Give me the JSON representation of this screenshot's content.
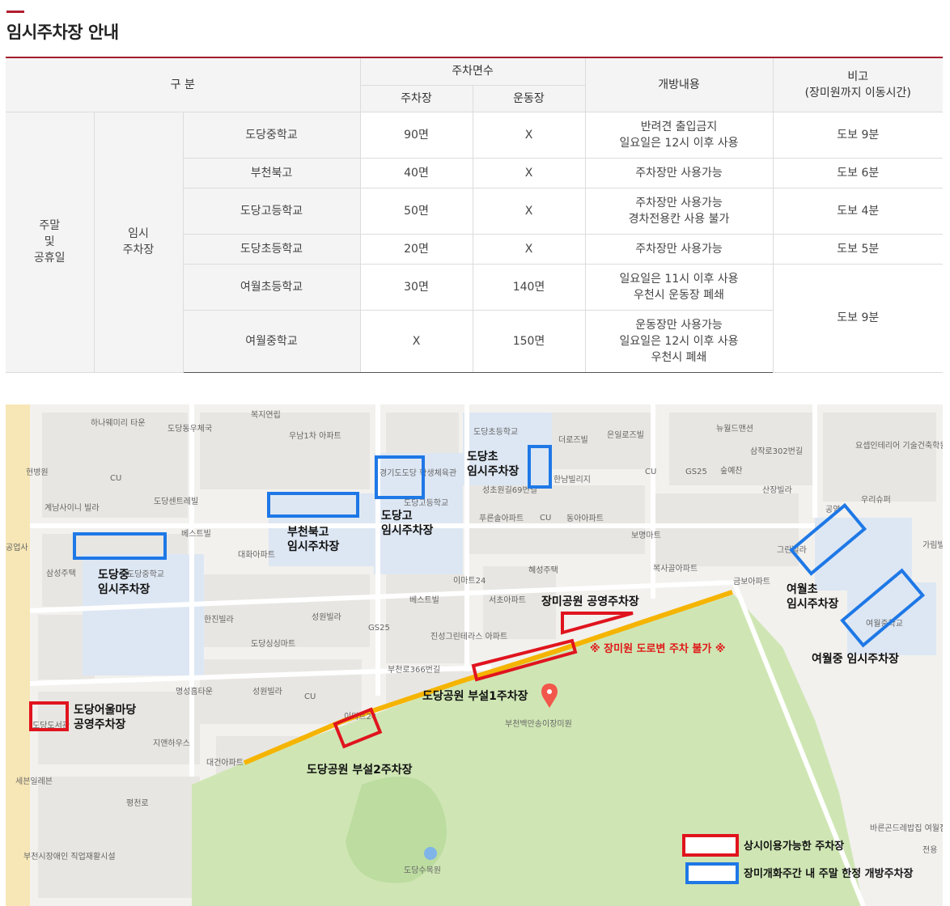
{
  "page": {
    "title": "임시주차장 안내"
  },
  "table": {
    "headers": {
      "division": "구 분",
      "capacity": "주차면수",
      "parking": "주차장",
      "field": "운동장",
      "open": "개방내용",
      "note": "비고\n(장미원까지 이동시간)"
    },
    "group_label": "주말\n및\n공휴일",
    "type_label": "임시\n주차장",
    "rows": [
      {
        "school": "도당중학교",
        "parking": "90면",
        "field": "X",
        "open": "반려견 출입금지\n일요일은 12시 이후 사용",
        "note": "도보 9분"
      },
      {
        "school": "부천북고",
        "parking": "40면",
        "field": "X",
        "open": "주차장만 사용가능",
        "note": "도보 6분"
      },
      {
        "school": "도당고등학교",
        "parking": "50면",
        "field": "X",
        "open": "주차장만 사용가능\n경차전용칸 사용 불가",
        "note": "도보 4분"
      },
      {
        "school": "도당초등학교",
        "parking": "20면",
        "field": "X",
        "open": "주차장만 사용가능",
        "note": "도보 5분"
      },
      {
        "school": "여월초등학교",
        "parking": "30면",
        "field": "140면",
        "open": "일요일은 11시 이후 사용\n우천시 운동장 폐쇄",
        "note": "도보 9분"
      },
      {
        "school": "여월중학교",
        "parking": "X",
        "field": "150면",
        "open": "운동장만 사용가능\n일요일은 12시 이후 사용\n우천시 폐쇄",
        "note": ""
      }
    ]
  },
  "map": {
    "parking_labels": {
      "dodang_middle": "도당중\n임시주차장",
      "bucheon_north": "부천북고\n임시주차장",
      "dodang_high": "도당고\n임시주차장",
      "dodang_elem": "도당초\n임시주차장",
      "yeowol_elem": "여월초\n임시주차장",
      "yeowol_middle": "여월중 임시주차장",
      "rose_park": "장미공원 공영주차장",
      "dodang_park1": "도당공원 부설1주차장",
      "dodang_park2": "도당공원 부설2주차장",
      "eoulmadang": "도당어울마당\n공영주차장"
    },
    "warning": "※ 장미원 도로변 주차 불가 ※",
    "destination": "부천백만송이장미원",
    "poi": {
      "haneul_miri": "하나웨미리\n타운",
      "dodang_post": "도당동우체국",
      "bokji": "복지연립",
      "unam": "우남1차\n아파트",
      "newworld": "뉴월드맨션",
      "samjak": "삼작로302번길",
      "yosep": "요셉인테리어\n기술건축학원",
      "dodang_elem_map": "도당초등학교",
      "deoroje": "더로즈빌",
      "eunil": "은일로즈빌",
      "cu1": "CU",
      "gs25a": "GS25",
      "sungyechan": "숲예찬",
      "sanjang": "산장빌라",
      "gongyeong": "공영",
      "uri": "우리슈퍼",
      "hyunbyungwon": "현병원",
      "gyenam": "계남사이니\n빌라",
      "dodang_central": "도당센트레빌",
      "gyeonggi_gym": "경기도도당\n학생체육관",
      "dodang_high_map": "도당고등학교",
      "hannam": "한남빌리지",
      "sungchowon": "성초원길69번길",
      "pureunsol": "푸른솔아파트",
      "donga": "동아아파트",
      "bomyeong": "보명마트",
      "green": "그린빌라",
      "bucheon_ywe": "부천여월\n초등학교",
      "garim": "가림빌",
      "gongeopsa": "공업사",
      "best": "베스트빌",
      "daehwa": "대화아파트",
      "samsung": "삼성주택",
      "dodang_middle_map": "도당중학교",
      "heseong": "혜성주택",
      "boksagol": "복사골아파트",
      "emart24": "이마트24",
      "bestvil2": "베스트빌",
      "seocho": "서초아파트",
      "geumbo": "금보아파트",
      "hanjin": "한진빌라",
      "seongwon": "성원빌라",
      "gs25b": "GS25",
      "jinseong": "진성그린테라스\n아파트",
      "yeowol_middle_map": "여월중학교",
      "dodang_mart": "도당싱싱마트",
      "bucheon366": "부천로366번길",
      "myeongseong": "명성홈타운",
      "seongwon2": "성원빌라",
      "cu2": "CU",
      "emart_cross": "이마트24",
      "jiaenheus": "지앤하우스",
      "daegeon": "대건아파트",
      "dodang_library": "도당도서관",
      "seven": "세븐일레븐",
      "bucheon_rehab": "부천시장애인\n직업재활시설",
      "dodang_sumokwon": "도당수목원",
      "bareunkids": "바른곤드레밥집\n여월점",
      "jeonyong": "전용",
      "pyeongcheonro": "평천로",
      "mart2": "마트"
    },
    "legend": {
      "always": "상시이용가능한 주차장",
      "weekend": "장미개화주간 내 주말 한정 개방주차장"
    },
    "colors": {
      "always": "#e0141e",
      "weekend": "#1e78e6",
      "road": "#f5b400",
      "park": "#cfe6b4",
      "accent": "#a31d2c"
    }
  }
}
